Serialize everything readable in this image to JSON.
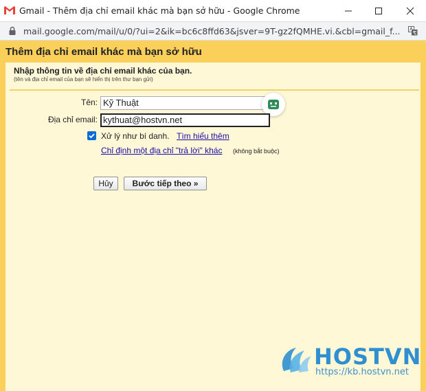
{
  "window": {
    "title": "Gmail - Thêm địa chỉ email khác mà bạn sở hữu - Google Chrome",
    "url": "mail.google.com/mail/u/0/?ui=2&ik=bc6c8ffd63&jsver=9T-gz2fQMHE.vi.&cbl=gmail_f..."
  },
  "dialog": {
    "title": "Thêm địa chỉ email khác mà bạn sở hữu",
    "heading": "Nhập thông tin về địa chỉ email khác của bạn.",
    "subheading": "(tên và địa chỉ email của bạn sẽ hiển thị trên thư bạn gửi)",
    "name_label": "Tên:",
    "name_value": "Kỹ Thuật",
    "email_label": "Địa chỉ email:",
    "email_value": "kythuat@hostvn.net",
    "alias_checked": true,
    "alias_label": "Xử lý như bí danh.",
    "learn_more": "Tìm hiểu thêm",
    "reply_to_link": "Chỉ định một địa chỉ \"trả lời\" khác",
    "optional": "(không bắt buộc)",
    "cancel_button": "Hủy",
    "next_button": "Bước tiếp theo »"
  },
  "watermark": {
    "brand": "HOSTVN",
    "url": "https://kb.hostvn.net"
  },
  "colors": {
    "dialog_border": "#fbd05a",
    "dialog_background": "#fff8d7",
    "link": "#1a0dab",
    "checkbox": "#0b6bd6",
    "watermark": "#2f8fd0"
  }
}
